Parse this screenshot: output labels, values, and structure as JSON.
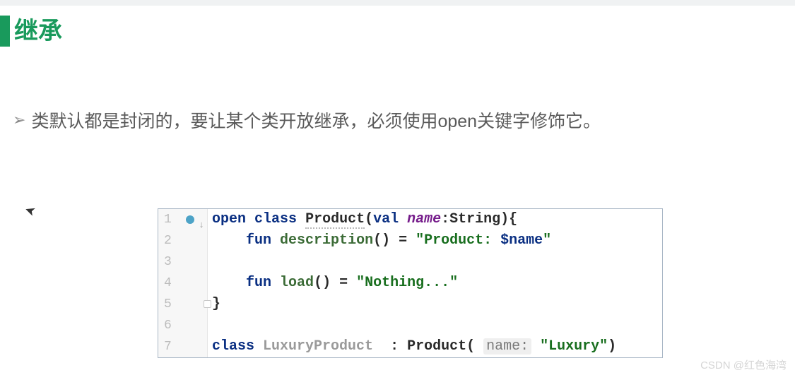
{
  "heading": "继承",
  "bullet": "类默认都是封闭的，要让某个类开放继承，必须使用open关键字修饰它。",
  "code": {
    "gutter": [
      "1",
      "2",
      "3",
      "4",
      "5",
      "6",
      "7"
    ],
    "line1": {
      "kw_open": "open",
      "kw_class": "class",
      "cls_name": "Product",
      "paren_open": "(",
      "kw_val": "val",
      "prop_name": "name",
      "colon_type": ":String",
      "paren_close_brace": "){"
    },
    "line2": {
      "indent": "    ",
      "kw_fun": "fun",
      "fn_name": "description",
      "parens_eq": "() = ",
      "str_open": "\"Product: ",
      "str_interp": "$name",
      "str_close": "\""
    },
    "line4": {
      "indent": "    ",
      "kw_fun": "fun",
      "fn_name": "load",
      "parens_eq": "() = ",
      "str": "\"Nothing...\""
    },
    "line5": {
      "close": "}"
    },
    "line7": {
      "kw_class": "class",
      "cls_name": "LuxuryProduct",
      "colon": "  : ",
      "super_name": "Product",
      "paren_open": "( ",
      "hint": "name:",
      "arg": " \"Luxury\"",
      "paren_close": ")"
    }
  },
  "watermark": "CSDN @红色海湾"
}
